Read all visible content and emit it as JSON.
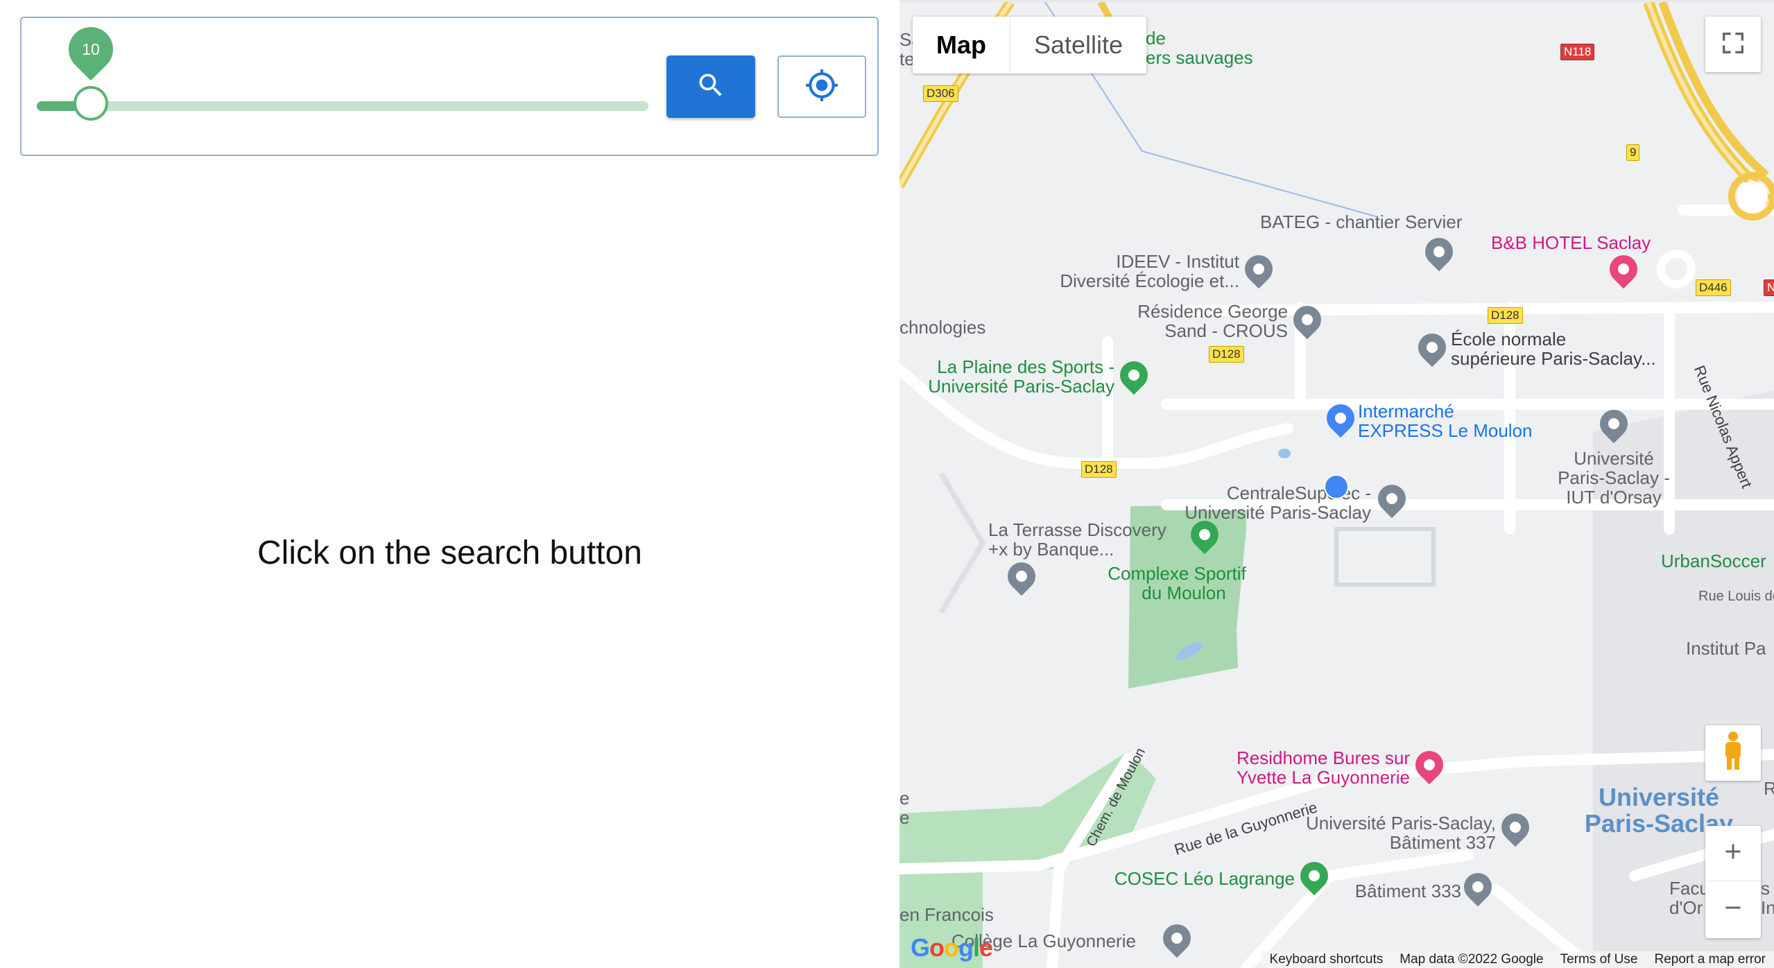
{
  "slider": {
    "value": "10",
    "fraction": 0.088
  },
  "hint_text": "Click on the search button",
  "icons": {
    "search": "search-icon",
    "locate": "my-location-icon",
    "fullscreen": "fullscreen-icon",
    "pegman": "street-view-pegman-icon",
    "zoom_in": "plus-icon",
    "zoom_out": "minus-icon"
  },
  "map": {
    "type_control": {
      "map": "Map",
      "satellite": "Satellite"
    },
    "labels": {
      "sa": "Sa",
      "te": "te",
      "de": "de",
      "ers_sauvages": "ers sauvages",
      "bateg": "BATEG - chantier Servier",
      "bb_hotel": "B&B HOTEL Saclay",
      "ideev_1": "IDEEV - Institut",
      "ideev_2": "Diversité Écologie et...",
      "residence_1": "Résidence George",
      "residence_2": "Sand - CROUS",
      "ens_1": "École normale",
      "ens_2": "supérieure Paris-Saclay...",
      "chnologies": "chnologies",
      "plaine_1": "La Plaine des Sports -",
      "plaine_2": "Université Paris-Saclay",
      "intermarche_1": "Intermarché",
      "intermarche_2": "EXPRESS Le Moulon",
      "ups_iut_1": "Université",
      "ups_iut_2": "Paris-Saclay -",
      "ups_iut_3": "IUT d'Orsay",
      "centrale_1": "CentraleSupélec -",
      "centrale_2": "Université Paris-Saclay",
      "terrasse_1": "La Terrasse Discovery",
      "terrasse_2": "+x by Banque...",
      "complexe_1": "Complexe Sportif",
      "complexe_2": "du Moulon",
      "urbansoccer": "UrbanSoccer",
      "rue_louis": "Rue Louis de",
      "institut_pa": "Institut Pa",
      "rue_nicolas": "Rue Nicolas Appert",
      "residhome_1": "Residhome Bures sur",
      "residhome_2": "Yvette La Guyonnerie",
      "chem_moulon": "Chem. de Moulon",
      "rue_guyonnerie": "Rue de la Guyonnerie",
      "ups_337_1": "Université Paris-Saclay,",
      "ups_337_2": "Bâtiment 337",
      "ups_big_1": "Université",
      "ups_big_2": "Paris-Saclay",
      "cosec": "COSEC Léo Lagrange",
      "bat_333": "Bâtiment 333",
      "facu_1": "Facu",
      "facu_2": "d'Or",
      "n_francois": "en Francois",
      "college": "Collège La Guyonnerie",
      "e1": "e",
      "e2": "e",
      "s_in_1": "s",
      "s_in_2": "In",
      "r_edge": "R"
    },
    "shields": {
      "d306": "D306",
      "n118": "N118",
      "d128_a": "D128",
      "d128_b": "D128",
      "d128_c": "D128",
      "d446": "D446",
      "n_edge": "N",
      "nine": "9"
    },
    "footer": {
      "keyboard": "Keyboard shortcuts",
      "map_data": "Map data ©2022 Google",
      "terms": "Terms of Use",
      "report": "Report a map error"
    },
    "logo": "Google"
  }
}
